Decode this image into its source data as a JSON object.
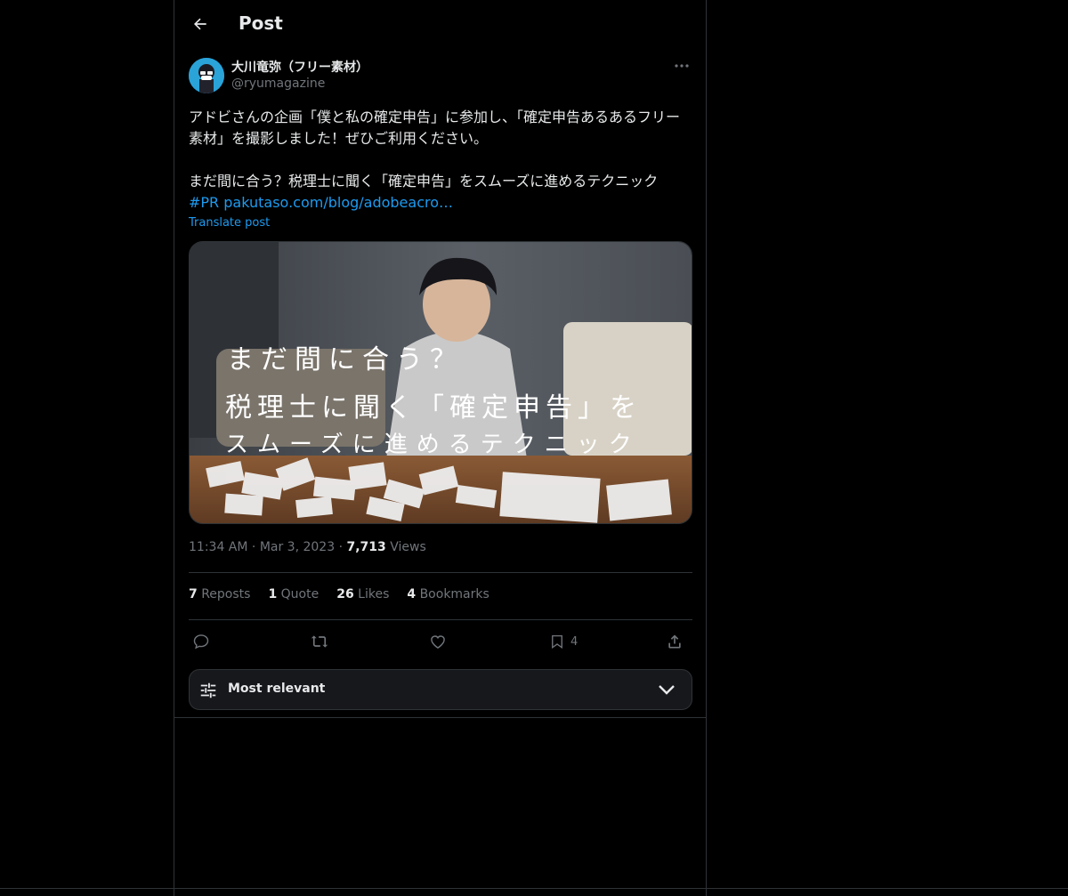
{
  "header": {
    "title": "Post"
  },
  "author": {
    "name": "大川竜弥（フリー素材）",
    "handle": "@ryumagazine"
  },
  "post": {
    "line1": "アドビさんの企画「僕と私の確定申告」に参加し、「確定申告あるあるフリー素材」を撮影しました！ぜひご利用ください。",
    "line2": "まだ間に合う？税理士に聞く「確定申告」をスムーズに進めるテクニック",
    "hashtag": "#PR",
    "link": "pakutaso.com/blog/adobeacro…",
    "translate_label": "Translate post"
  },
  "media": {
    "overlay_line1": "まだ間に合う？",
    "overlay_line2": "税理士に聞く「確定申告」を",
    "overlay_line3": "スムーズに進めるテクニック"
  },
  "meta": {
    "time": "11:34 AM",
    "date": "Mar 3, 2023",
    "views_count": "7,713",
    "views_label": "Views"
  },
  "stats": {
    "reposts_count": "7",
    "reposts_label": "Reposts",
    "quote_count": "1",
    "quote_label": "Quote",
    "likes_count": "26",
    "likes_label": "Likes",
    "bookmarks_count": "4",
    "bookmarks_label": "Bookmarks"
  },
  "actions": {
    "bookmark_count": "4"
  },
  "sort": {
    "label": "Most relevant"
  },
  "colors": {
    "accent": "#1d9bf0",
    "muted": "#71767b",
    "text": "#e7e9ea",
    "border": "#2f3336"
  }
}
